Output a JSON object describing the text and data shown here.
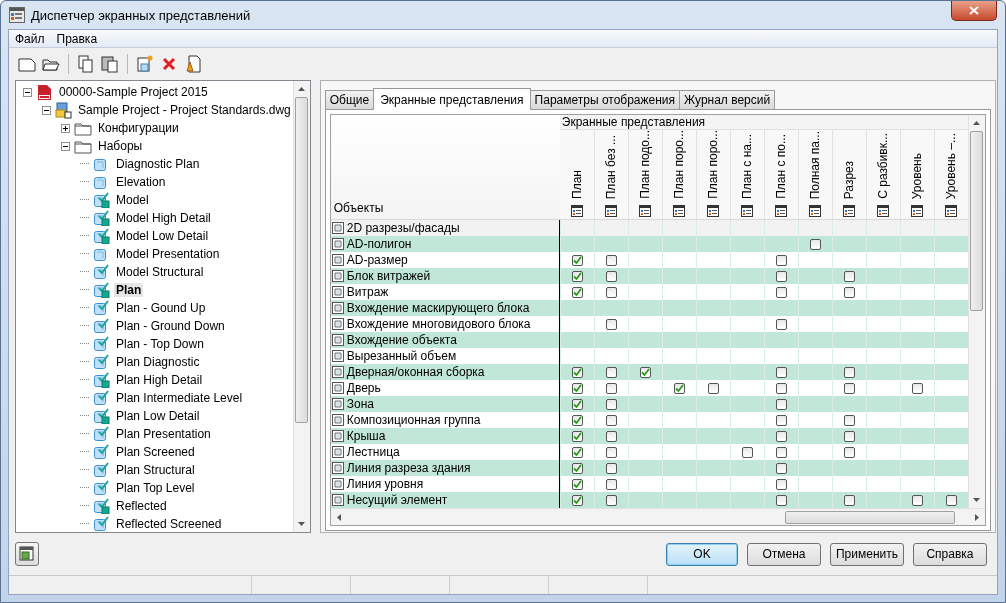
{
  "window": {
    "title": "Диспетчер экранных представлений"
  },
  "menu": [
    "Файл",
    "Правка"
  ],
  "tree": [
    {
      "label": "00000-Sample Project 2015",
      "kind": "project",
      "expanded": true,
      "selected": false,
      "children": [
        {
          "label": "Sample Project - Project Standards.dwg",
          "kind": "drawing",
          "expanded": true,
          "selected": false,
          "children": [
            {
              "label": "Конфигурации",
              "kind": "folder",
              "expanded": false,
              "selected": false
            },
            {
              "label": "Наборы",
              "kind": "folder",
              "expanded": true,
              "selected": false,
              "children": [
                {
                  "label": "Diagnostic Plan",
                  "kind": "set",
                  "checked": false,
                  "marked": false,
                  "selected": false
                },
                {
                  "label": "Elevation",
                  "kind": "set",
                  "checked": false,
                  "marked": false,
                  "selected": false
                },
                {
                  "label": "Model",
                  "kind": "set",
                  "checked": true,
                  "marked": true,
                  "selected": false
                },
                {
                  "label": "Model High Detail",
                  "kind": "set",
                  "checked": true,
                  "marked": true,
                  "selected": false
                },
                {
                  "label": "Model Low Detail",
                  "kind": "set",
                  "checked": true,
                  "marked": true,
                  "selected": false
                },
                {
                  "label": "Model Presentation",
                  "kind": "set",
                  "checked": false,
                  "marked": false,
                  "selected": false
                },
                {
                  "label": "Model Structural",
                  "kind": "set",
                  "checked": true,
                  "marked": false,
                  "selected": false
                },
                {
                  "label": "Plan",
                  "kind": "set",
                  "checked": true,
                  "marked": true,
                  "selected": true
                },
                {
                  "label": "Plan - Gound Up",
                  "kind": "set",
                  "checked": true,
                  "marked": false,
                  "selected": false
                },
                {
                  "label": "Plan - Ground Down",
                  "kind": "set",
                  "checked": true,
                  "marked": false,
                  "selected": false
                },
                {
                  "label": "Plan - Top Down",
                  "kind": "set",
                  "checked": true,
                  "marked": false,
                  "selected": false
                },
                {
                  "label": "Plan Diagnostic",
                  "kind": "set",
                  "checked": true,
                  "marked": false,
                  "selected": false
                },
                {
                  "label": "Plan High Detail",
                  "kind": "set",
                  "checked": true,
                  "marked": true,
                  "selected": false
                },
                {
                  "label": "Plan Intermediate Level",
                  "kind": "set",
                  "checked": true,
                  "marked": false,
                  "selected": false
                },
                {
                  "label": "Plan Low Detail",
                  "kind": "set",
                  "checked": true,
                  "marked": true,
                  "selected": false
                },
                {
                  "label": "Plan Presentation",
                  "kind": "set",
                  "checked": true,
                  "marked": false,
                  "selected": false
                },
                {
                  "label": "Plan Screened",
                  "kind": "set",
                  "checked": true,
                  "marked": false,
                  "selected": false
                },
                {
                  "label": "Plan Structural",
                  "kind": "set",
                  "checked": true,
                  "marked": false,
                  "selected": false
                },
                {
                  "label": "Plan Top Level",
                  "kind": "set",
                  "checked": true,
                  "marked": false,
                  "selected": false
                },
                {
                  "label": "Reflected",
                  "kind": "set",
                  "checked": true,
                  "marked": true,
                  "selected": false
                },
                {
                  "label": "Reflected Screened",
                  "kind": "set",
                  "checked": true,
                  "marked": false,
                  "selected": false
                }
              ]
            }
          ]
        }
      ]
    }
  ],
  "tabs": [
    {
      "label": "Общие",
      "selected": false
    },
    {
      "label": "Экранные представления",
      "selected": true
    },
    {
      "label": "Параметры отображения",
      "selected": false
    },
    {
      "label": "Журнал версий",
      "selected": false
    }
  ],
  "table": {
    "objects_heading": "Объекты",
    "group_heading": "Экранные представления",
    "columns": [
      "План",
      "План без ...",
      "План подо...",
      "План поро...",
      "План поро...",
      "План с на...",
      "План с по...",
      "Полная па...",
      "Разрез",
      "С разбивк...",
      "Уровень",
      "Уровень –..."
    ],
    "rows": [
      {
        "name": "2D разрезы/фасады",
        "cells": [
          null,
          null,
          null,
          null,
          null,
          null,
          null,
          null,
          null,
          null,
          null,
          null
        ]
      },
      {
        "name": "AD-полигон",
        "cells": [
          null,
          null,
          null,
          null,
          null,
          null,
          null,
          false,
          null,
          null,
          null,
          null
        ]
      },
      {
        "name": "AD-размер",
        "cells": [
          true,
          false,
          null,
          null,
          null,
          null,
          false,
          null,
          null,
          null,
          null,
          null
        ]
      },
      {
        "name": "Блок витражей",
        "cells": [
          true,
          false,
          null,
          null,
          null,
          null,
          false,
          null,
          false,
          null,
          null,
          null
        ]
      },
      {
        "name": "Витраж",
        "cells": [
          true,
          false,
          null,
          null,
          null,
          null,
          false,
          null,
          false,
          null,
          null,
          null
        ]
      },
      {
        "name": "Вхождение маскирующего блока",
        "cells": [
          null,
          null,
          null,
          null,
          null,
          null,
          null,
          null,
          null,
          null,
          null,
          null
        ]
      },
      {
        "name": "Вхождение многовидового блока",
        "cells": [
          null,
          false,
          null,
          null,
          null,
          null,
          false,
          null,
          null,
          null,
          null,
          null
        ]
      },
      {
        "name": "Вхождение объекта",
        "cells": [
          null,
          null,
          null,
          null,
          null,
          null,
          null,
          null,
          null,
          null,
          null,
          null
        ]
      },
      {
        "name": "Вырезанный объем",
        "cells": [
          null,
          null,
          null,
          null,
          null,
          null,
          null,
          null,
          null,
          null,
          null,
          null
        ]
      },
      {
        "name": "Дверная/оконная сборка",
        "cells": [
          true,
          false,
          true,
          null,
          null,
          null,
          false,
          null,
          false,
          null,
          null,
          null
        ]
      },
      {
        "name": "Дверь",
        "cells": [
          true,
          false,
          null,
          true,
          false,
          null,
          false,
          null,
          false,
          null,
          false,
          null
        ]
      },
      {
        "name": "Зона",
        "cells": [
          true,
          false,
          null,
          null,
          null,
          null,
          false,
          null,
          null,
          null,
          null,
          null
        ]
      },
      {
        "name": "Композиционная группа",
        "cells": [
          true,
          false,
          null,
          null,
          null,
          null,
          false,
          null,
          false,
          null,
          null,
          null
        ]
      },
      {
        "name": "Крыша",
        "cells": [
          true,
          false,
          null,
          null,
          null,
          null,
          false,
          null,
          false,
          null,
          null,
          null
        ]
      },
      {
        "name": "Лестница",
        "cells": [
          true,
          false,
          null,
          null,
          null,
          false,
          false,
          null,
          false,
          null,
          null,
          null
        ]
      },
      {
        "name": "Линия разреза здания",
        "cells": [
          true,
          false,
          null,
          null,
          null,
          null,
          false,
          null,
          null,
          null,
          null,
          null
        ]
      },
      {
        "name": "Линия уровня",
        "cells": [
          true,
          false,
          null,
          null,
          null,
          null,
          false,
          null,
          null,
          null,
          null,
          null
        ]
      },
      {
        "name": "Несущий элемент",
        "cells": [
          true,
          false,
          null,
          null,
          null,
          null,
          false,
          null,
          false,
          null,
          false,
          false
        ]
      }
    ]
  },
  "buttons": [
    {
      "label": "OK",
      "kind": "default"
    },
    {
      "label": "Отмена",
      "kind": "normal"
    },
    {
      "label": "Применить",
      "kind": "normal"
    },
    {
      "label": "Справка",
      "kind": "normal"
    }
  ]
}
